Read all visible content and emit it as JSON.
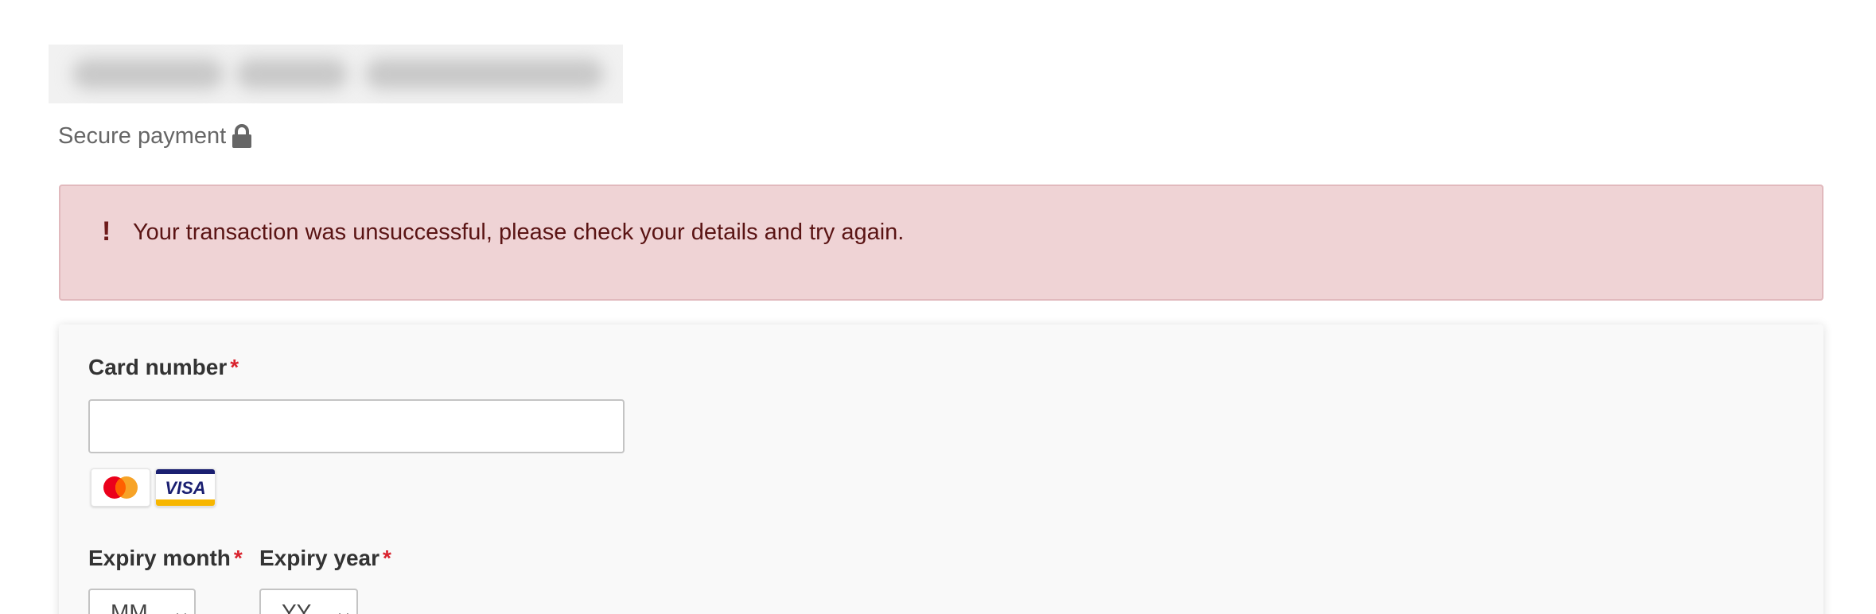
{
  "header": {
    "secure_label": "Secure payment",
    "lock_icon": "lock-icon"
  },
  "alert": {
    "icon": "!",
    "message": "Your transaction was unsuccessful, please check your details and try again.",
    "colors": {
      "background": "#efd3d5",
      "border": "#e1b9bd",
      "text": "#5a1414"
    }
  },
  "form": {
    "card_number": {
      "label": "Card number",
      "required_marker": "*",
      "value": "",
      "placeholder": ""
    },
    "accepted_cards": [
      "mastercard-logo",
      "visa-logo"
    ],
    "visa_text": "VISA",
    "expiry_month": {
      "label": "Expiry month",
      "required_marker": "*",
      "selected": "MM"
    },
    "expiry_year": {
      "label": "Expiry year",
      "required_marker": "*",
      "selected": "YY"
    }
  },
  "colors": {
    "required": "#d9232e",
    "label": "#333333",
    "panel": "#f9f9f9"
  }
}
